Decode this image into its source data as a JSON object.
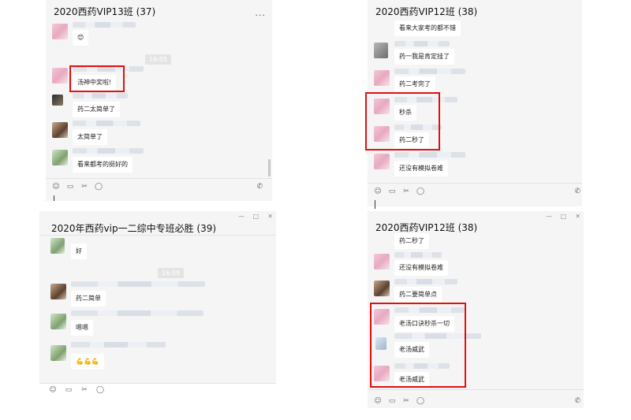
{
  "w1": {
    "title": "2020西药VIP13班 (37)",
    "time": "16:05",
    "messages": [
      "😊",
      "汤神中奖啦!",
      "药二太简单了",
      "太简单了",
      "看来都考的挺好的"
    ],
    "menu": "..."
  },
  "w2": {
    "title": "2020西药VIP12班 (38)",
    "messages": [
      "看来大家考的都不错",
      "药一我是肯定挂了",
      "药二考完了",
      "秒杀",
      "药二秒了",
      "还没有模拟卷难"
    ]
  },
  "w3": {
    "title": "2020年西药vip一二综中专班必胜 (39)",
    "time": "16:09",
    "messages": [
      "好",
      "药二简单",
      "嗯嗯",
      "💪💪💪"
    ]
  },
  "w4": {
    "title": "2020西药VIP12班 (38)",
    "messages": [
      "药二秒了",
      "还没有模拟卷难",
      "药二要简单点",
      "老汤口诀秒杀一切",
      "老汤威武",
      "老汤威武"
    ]
  },
  "controls": {
    "min": "—",
    "max": "□",
    "close": "✕"
  },
  "toolbar_icons": [
    "emoji-icon",
    "folder-icon",
    "scissors-icon",
    "chat-icon"
  ],
  "colors": {
    "highlight": "#e01010",
    "window_bg": "#f5f5f5",
    "bubble_bg": "#ffffff"
  }
}
